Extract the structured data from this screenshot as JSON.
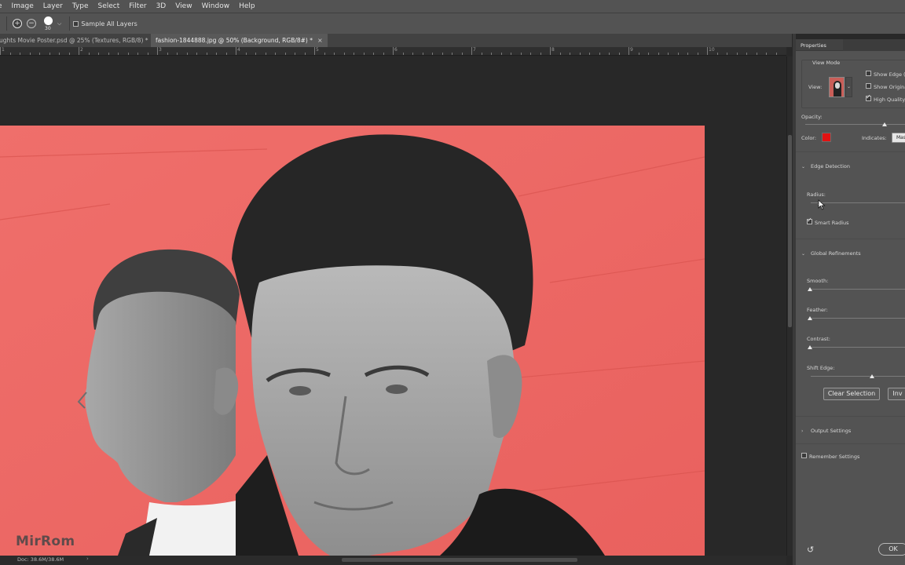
{
  "menu": [
    "e",
    "Image",
    "Layer",
    "Type",
    "Select",
    "Filter",
    "3D",
    "View",
    "Window",
    "Help"
  ],
  "options": {
    "add_icon": "plus-circle-icon",
    "subtract_icon": "minus-circle-icon",
    "brush_size": "30",
    "sample_all_layers": "Sample All Layers"
  },
  "tabs": [
    {
      "label": "ughts Movie Poster.psd @ 25% (Textures, RGB/8) *",
      "active": false
    },
    {
      "label": "fashion-1844888.jpg @ 50% (Background, RGB/8#) *",
      "active": true
    }
  ],
  "ruler_labels": [
    "1",
    "2",
    "3",
    "4",
    "5",
    "6",
    "7",
    "8",
    "9",
    "10"
  ],
  "canvas": {
    "overlay_color": "#ee6b68",
    "status": "Doc: 38.6M/38.6M",
    "watermark": "MirRom"
  },
  "properties": {
    "tab_title": "Properties",
    "view_mode_label": "View Mode",
    "view_label": "View:",
    "show_edge": "Show Edge (J",
    "show_original": "Show Original",
    "high_quality": "High Quality P",
    "high_quality_checked": true,
    "opacity_label": "Opacity:",
    "opacity_percent": 80,
    "color_label": "Color:",
    "color_value": "#e21212",
    "indicates_label": "Indicates:",
    "indicates_value": "Mas",
    "edge_detection": "Edge Detection",
    "radius_label": "Radius:",
    "radius_value_px": 1,
    "smart_radius": "Smart Radius",
    "smart_radius_checked": true,
    "global_refinements": "Global Refinements",
    "smooth_label": "Smooth:",
    "feather_label": "Feather:",
    "contrast_label": "Contrast:",
    "shift_edge_label": "Shift Edge:",
    "shift_edge_percent": 65,
    "clear_selection": "Clear Selection",
    "invert": "Inv",
    "output_settings": "Output Settings",
    "remember_settings": "Remember Settings",
    "ok": "OK",
    "reset_icon": "reset-arrow-icon"
  }
}
